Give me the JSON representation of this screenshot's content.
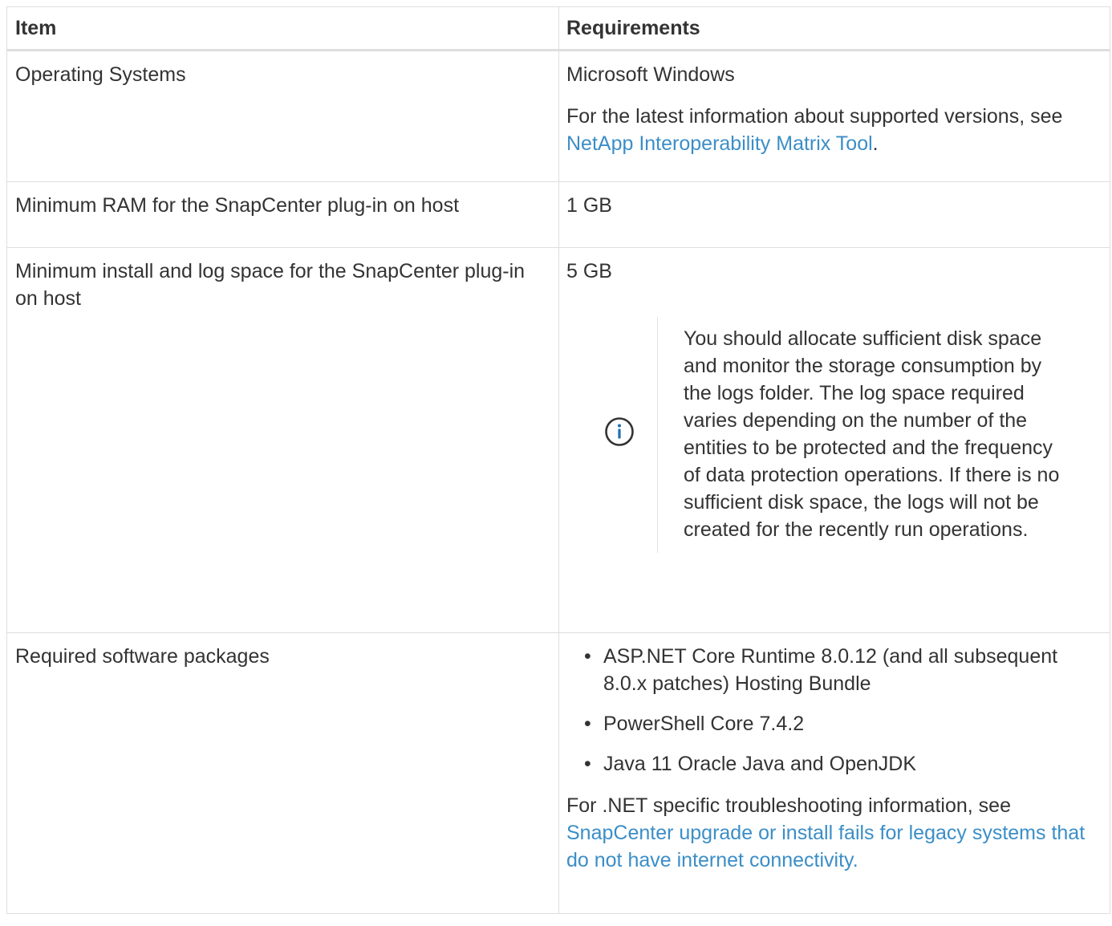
{
  "table": {
    "headers": {
      "item": "Item",
      "requirements": "Requirements"
    },
    "rows": [
      {
        "item": "Operating Systems",
        "requirement": "Microsoft Windows",
        "info_text": "For the latest information about supported versions, see ",
        "info_link": "NetApp Interoperability Matrix Tool",
        "info_suffix": "."
      },
      {
        "item": "Minimum RAM for the SnapCenter plug-in on host",
        "requirement": "1 GB"
      },
      {
        "item": "Minimum install and log space for the SnapCenter plug-in on host",
        "requirement": "5 GB",
        "note": {
          "icon": "info-circle-icon",
          "text": "You should allocate sufficient disk space and monitor the storage consumption by the logs folder. The log space required varies depending on the number of the entities to be protected and the frequency of data protection operations. If there is no sufficient disk space, the logs will not be created for the recently run operations."
        }
      },
      {
        "item": "Required software packages",
        "packages": [
          "ASP.NET Core Runtime 8.0.12 (and all subsequent 8.0.x patches) Hosting Bundle",
          "PowerShell Core 7.4.2",
          "Java 11 Oracle Java and OpenJDK"
        ],
        "info_text": "For .NET specific troubleshooting information, see ",
        "info_link": "SnapCenter upgrade or install fails for legacy systems that do not have internet connectivity."
      }
    ]
  },
  "colors": {
    "text": "#333333",
    "link": "#3b8ec7",
    "border": "#dedede",
    "icon": "#1f6fb2"
  }
}
